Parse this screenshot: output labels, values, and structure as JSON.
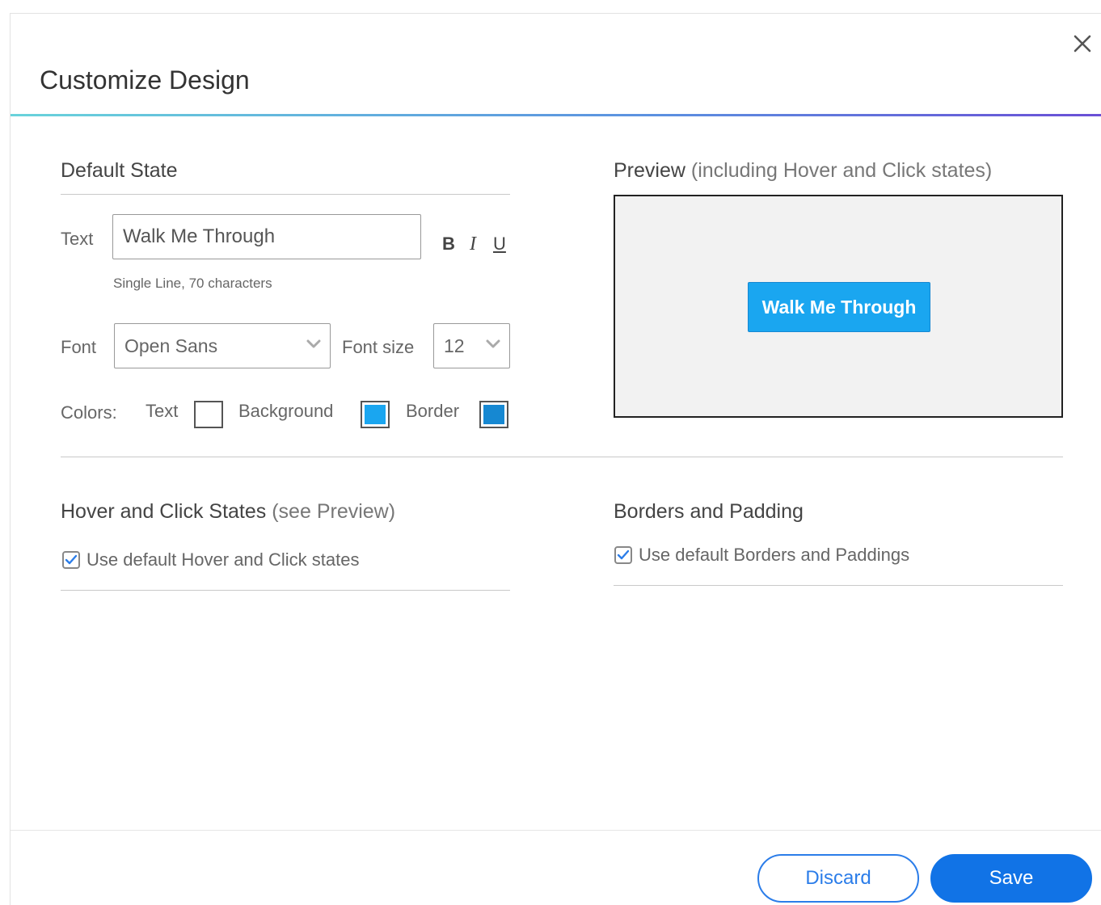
{
  "dialog": {
    "title": "Customize Design"
  },
  "default_state": {
    "title": "Default State",
    "text_label": "Text",
    "text_value": "Walk Me Through",
    "bold_label": "B",
    "italic_label": "I",
    "underline_label": "U",
    "hint": "Single Line, 70 characters",
    "font_label": "Font",
    "font_value": "Open Sans",
    "font_size_label": "Font size",
    "font_size_value": "12",
    "colors_label": "Colors:",
    "color_text_label": "Text",
    "color_background_label": "Background",
    "color_border_label": "Border"
  },
  "colors": {
    "text": "#ffffff",
    "background": "#1aa6f0",
    "border": "#1688d2"
  },
  "preview": {
    "title": "Preview",
    "subtitle": "(including Hover and Click states)",
    "button_text": "Walk Me Through"
  },
  "hover": {
    "title": "Hover and Click States",
    "subtitle": "(see Preview)",
    "checkbox_label": "Use default Hover and Click states",
    "checked": true
  },
  "borders": {
    "title": "Borders and Padding",
    "checkbox_label": "Use default Borders and Paddings",
    "checked": true
  },
  "footer": {
    "discard_label": "Discard",
    "save_label": "Save"
  }
}
